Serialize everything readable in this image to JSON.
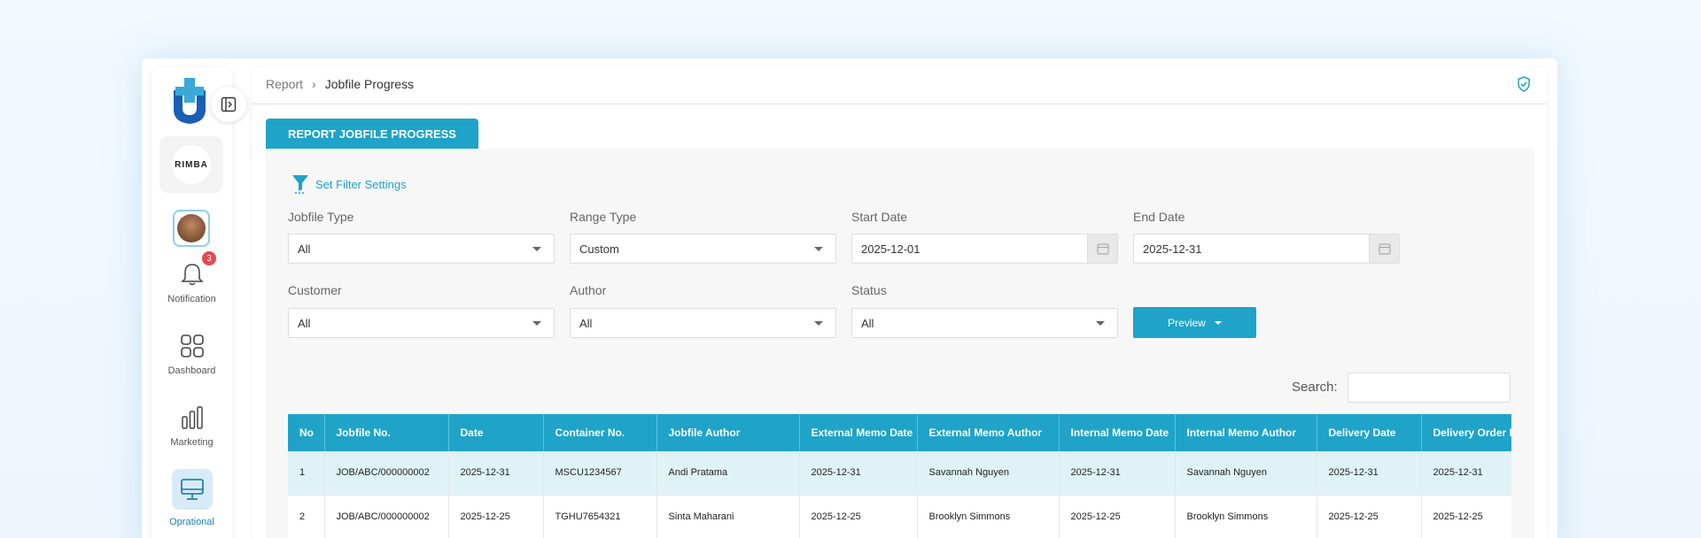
{
  "sidebar": {
    "brand_text": "RIMBA",
    "notification_count": "3",
    "items": [
      {
        "label": "Notification",
        "icon": "bell-icon"
      },
      {
        "label": "Dashboard",
        "icon": "grid-icon"
      },
      {
        "label": "Marketing",
        "icon": "bar-chart-icon"
      },
      {
        "label": "Oprational",
        "icon": "monitor-icon",
        "active": true
      }
    ]
  },
  "header": {
    "breadcrumb": {
      "parent": "Report",
      "separator": "›",
      "current": "Jobfile Progress"
    }
  },
  "tab": {
    "label": "REPORT JOBFILE PROGRESS"
  },
  "filters": {
    "title": "Set Filter Settings",
    "jobfile_type": {
      "label": "Jobfile Type",
      "value": "All"
    },
    "range_type": {
      "label": "Range Type",
      "value": "Custom"
    },
    "start_date": {
      "label": "Start Date",
      "value": "2025-12-01"
    },
    "end_date": {
      "label": "End Date",
      "value": "2025-12-31"
    },
    "customer": {
      "label": "Customer",
      "value": "All"
    },
    "author": {
      "label": "Author",
      "value": "All"
    },
    "status": {
      "label": "Status",
      "value": "All"
    },
    "preview_label": "Preview"
  },
  "search": {
    "label": "Search:",
    "value": ""
  },
  "table": {
    "columns": [
      "No",
      "Jobfile No.",
      "Date",
      "Container No.",
      "Jobfile Author",
      "External Memo Date",
      "External Memo Author",
      "Internal Memo Date",
      "Internal Memo Author",
      "Delivery Date",
      "Delivery Order Date"
    ],
    "rows": [
      [
        "1",
        "JOB/ABC/000000002",
        "2025-12-31",
        "MSCU1234567",
        "Andi Pratama",
        "2025-12-31",
        "Savannah Nguyen",
        "2025-12-31",
        "Savannah Nguyen",
        "2025-12-31",
        "2025-12-31"
      ],
      [
        "2",
        "JOB/ABC/000000002",
        "2025-12-25",
        "TGHU7654321",
        "Sinta Maharani",
        "2025-12-25",
        "Brooklyn Simmons",
        "2025-12-25",
        "Brooklyn Simmons",
        "2025-12-25",
        "2025-12-25"
      ]
    ]
  },
  "colors": {
    "accent": "#1fa3c8",
    "row_highlight": "#dff3f7",
    "badge": "#e5484d"
  }
}
